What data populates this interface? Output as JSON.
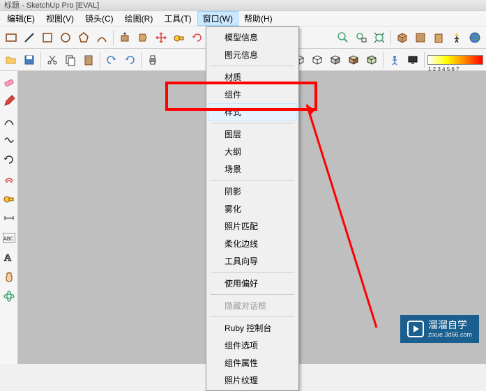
{
  "title": "标题 - SketchUp Pro [EVAL]",
  "menus": {
    "edit": "编辑(E)",
    "view": "视图(V)",
    "camera": "镜头(C)",
    "draw": "绘图(R)",
    "tools": "工具(T)",
    "window": "窗口(W)",
    "help": "帮助(H)"
  },
  "dropdown": {
    "model_info": "模型信息",
    "entity_info": "图元信息",
    "materials": "材质",
    "components": "组件",
    "styles": "样式",
    "layers": "图层",
    "outliner": "大纲",
    "scenes": "场景",
    "shadows": "阴影",
    "fog": "雾化",
    "photo_match": "照片匹配",
    "soften": "柔化边线",
    "instructor": "工具向导",
    "preferences": "使用偏好",
    "hide_dialogs": "隐藏对话框",
    "ruby_console": "Ruby 控制台",
    "component_options": "组件选项",
    "component_attrs": "组件属性",
    "photo_textures": "照片纹理"
  },
  "watermark": {
    "title": "溜溜自学",
    "sub": "zixue.3d66.com"
  },
  "gradient_nums": "1 2 3 4 5 6 7"
}
